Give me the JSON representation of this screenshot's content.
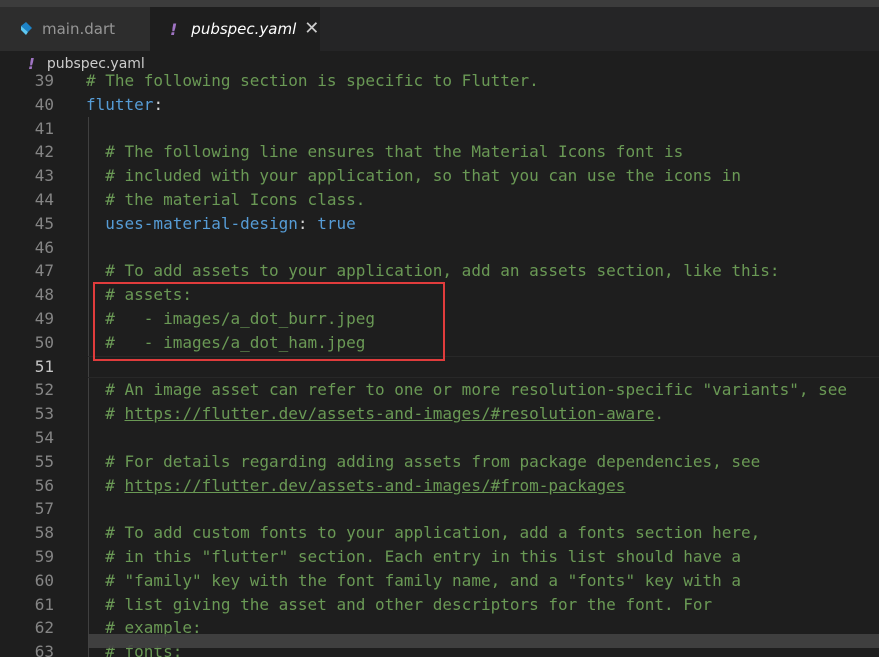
{
  "tabs": [
    {
      "label": "main.dart",
      "icon": "dart-icon",
      "active": false
    },
    {
      "label": "pubspec.yaml",
      "icon": "yaml-icon",
      "active": true,
      "close": "✕"
    }
  ],
  "breadcrumb": {
    "icon": "!",
    "label": "pubspec.yaml"
  },
  "yaml_icon_glyph": "!",
  "highlight_color": "#e03c3c",
  "editor": {
    "active_line": 51,
    "lines": [
      {
        "n": "39",
        "parts": [
          {
            "t": "# The following section is specific to Flutter.",
            "k": "c"
          }
        ]
      },
      {
        "n": "40",
        "parts": [
          {
            "t": "flutter",
            "k": "key"
          },
          {
            "t": ":",
            "k": "punct"
          }
        ]
      },
      {
        "n": "41",
        "parts": []
      },
      {
        "n": "42",
        "parts": [
          {
            "t": "  # The following line ensures that the Material Icons font is",
            "k": "c"
          }
        ]
      },
      {
        "n": "43",
        "parts": [
          {
            "t": "  # included with your application, so that you can use the icons in",
            "k": "c"
          }
        ]
      },
      {
        "n": "44",
        "parts": [
          {
            "t": "  # the material Icons class.",
            "k": "c"
          }
        ]
      },
      {
        "n": "45",
        "parts": [
          {
            "t": "  ",
            "k": "punct"
          },
          {
            "t": "uses-material-design",
            "k": "key"
          },
          {
            "t": ": ",
            "k": "punct"
          },
          {
            "t": "true",
            "k": "val"
          }
        ]
      },
      {
        "n": "46",
        "parts": []
      },
      {
        "n": "47",
        "parts": [
          {
            "t": "  # To add assets to your application, add an assets section, like this:",
            "k": "c"
          }
        ]
      },
      {
        "n": "48",
        "parts": [
          {
            "t": "  # assets:",
            "k": "c"
          }
        ]
      },
      {
        "n": "49",
        "parts": [
          {
            "t": "  #   - images/a_dot_burr.jpeg",
            "k": "c"
          }
        ]
      },
      {
        "n": "50",
        "parts": [
          {
            "t": "  #   - images/a_dot_ham.jpeg",
            "k": "c"
          }
        ]
      },
      {
        "n": "51",
        "parts": []
      },
      {
        "n": "52",
        "parts": [
          {
            "t": "  # An image asset can refer to one or more resolution-specific \"variants\", see",
            "k": "c"
          }
        ]
      },
      {
        "n": "53",
        "parts": [
          {
            "t": "  # ",
            "k": "c"
          },
          {
            "t": "https://flutter.dev/assets-and-images/#resolution-aware",
            "k": "link"
          },
          {
            "t": ".",
            "k": "c"
          }
        ]
      },
      {
        "n": "54",
        "parts": []
      },
      {
        "n": "55",
        "parts": [
          {
            "t": "  # For details regarding adding assets from package dependencies, see",
            "k": "c"
          }
        ]
      },
      {
        "n": "56",
        "parts": [
          {
            "t": "  # ",
            "k": "c"
          },
          {
            "t": "https://flutter.dev/assets-and-images/#from-packages",
            "k": "link"
          }
        ]
      },
      {
        "n": "57",
        "parts": []
      },
      {
        "n": "58",
        "parts": [
          {
            "t": "  # To add custom fonts to your application, add a fonts section here,",
            "k": "c"
          }
        ]
      },
      {
        "n": "59",
        "parts": [
          {
            "t": "  # in this \"flutter\" section. Each entry in this list should have a",
            "k": "c"
          }
        ]
      },
      {
        "n": "60",
        "parts": [
          {
            "t": "  # \"family\" key with the font family name, and a \"fonts\" key with a",
            "k": "c"
          }
        ]
      },
      {
        "n": "61",
        "parts": [
          {
            "t": "  # list giving the asset and other descriptors for the font. For",
            "k": "c"
          }
        ]
      },
      {
        "n": "62",
        "parts": [
          {
            "t": "  # example:",
            "k": "c"
          }
        ]
      },
      {
        "n": "63",
        "parts": [
          {
            "t": "  # fonts:",
            "k": "c"
          }
        ]
      }
    ]
  }
}
